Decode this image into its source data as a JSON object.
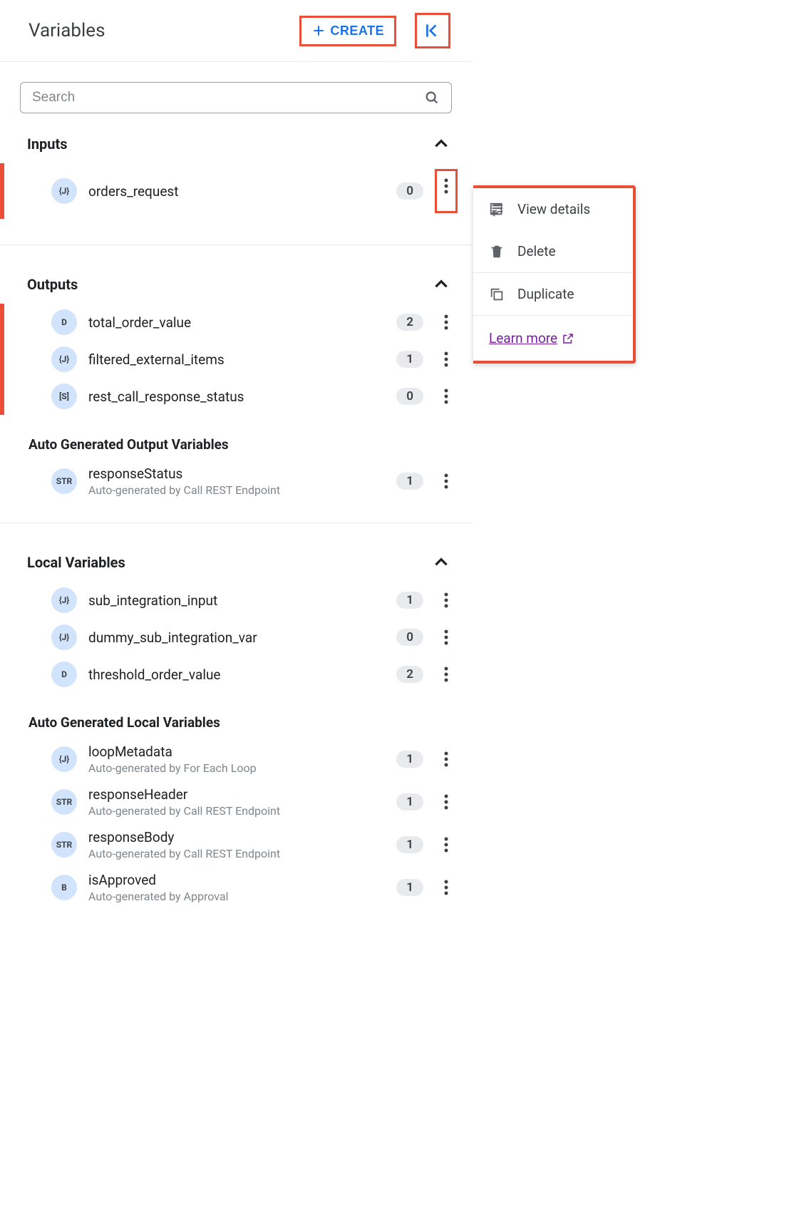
{
  "header": {
    "title": "Variables",
    "create_label": "CREATE"
  },
  "search": {
    "placeholder": "Search"
  },
  "sections": {
    "inputs": {
      "title": "Inputs",
      "items": [
        {
          "type": "{J}",
          "name": "orders_request",
          "count": "0"
        }
      ]
    },
    "outputs": {
      "title": "Outputs",
      "items": [
        {
          "type": "D",
          "name": "total_order_value",
          "count": "2"
        },
        {
          "type": "{J}",
          "name": "filtered_external_items",
          "count": "1"
        },
        {
          "type": "[S]",
          "name": "rest_call_response_status",
          "count": "0"
        }
      ],
      "auto_title": "Auto Generated Output Variables",
      "auto_items": [
        {
          "type": "STR",
          "name": "responseStatus",
          "sub": "Auto-generated by Call REST Endpoint",
          "count": "1"
        }
      ]
    },
    "locals": {
      "title": "Local Variables",
      "items": [
        {
          "type": "{J}",
          "name": "sub_integration_input",
          "count": "1"
        },
        {
          "type": "{J}",
          "name": "dummy_sub_integration_var",
          "count": "0"
        },
        {
          "type": "D",
          "name": "threshold_order_value",
          "count": "2"
        }
      ],
      "auto_title": "Auto Generated Local Variables",
      "auto_items": [
        {
          "type": "{J}",
          "name": "loopMetadata",
          "sub": "Auto-generated by For Each Loop",
          "count": "1"
        },
        {
          "type": "STR",
          "name": "responseHeader",
          "sub": "Auto-generated by Call REST Endpoint",
          "count": "1"
        },
        {
          "type": "STR",
          "name": "responseBody",
          "sub": "Auto-generated by Call REST Endpoint",
          "count": "1"
        },
        {
          "type": "B",
          "name": "isApproved",
          "sub": "Auto-generated by Approval",
          "count": "1"
        }
      ]
    }
  },
  "context_menu": {
    "view_details": "View details",
    "delete": "Delete",
    "duplicate": "Duplicate",
    "learn_more": "Learn more"
  }
}
